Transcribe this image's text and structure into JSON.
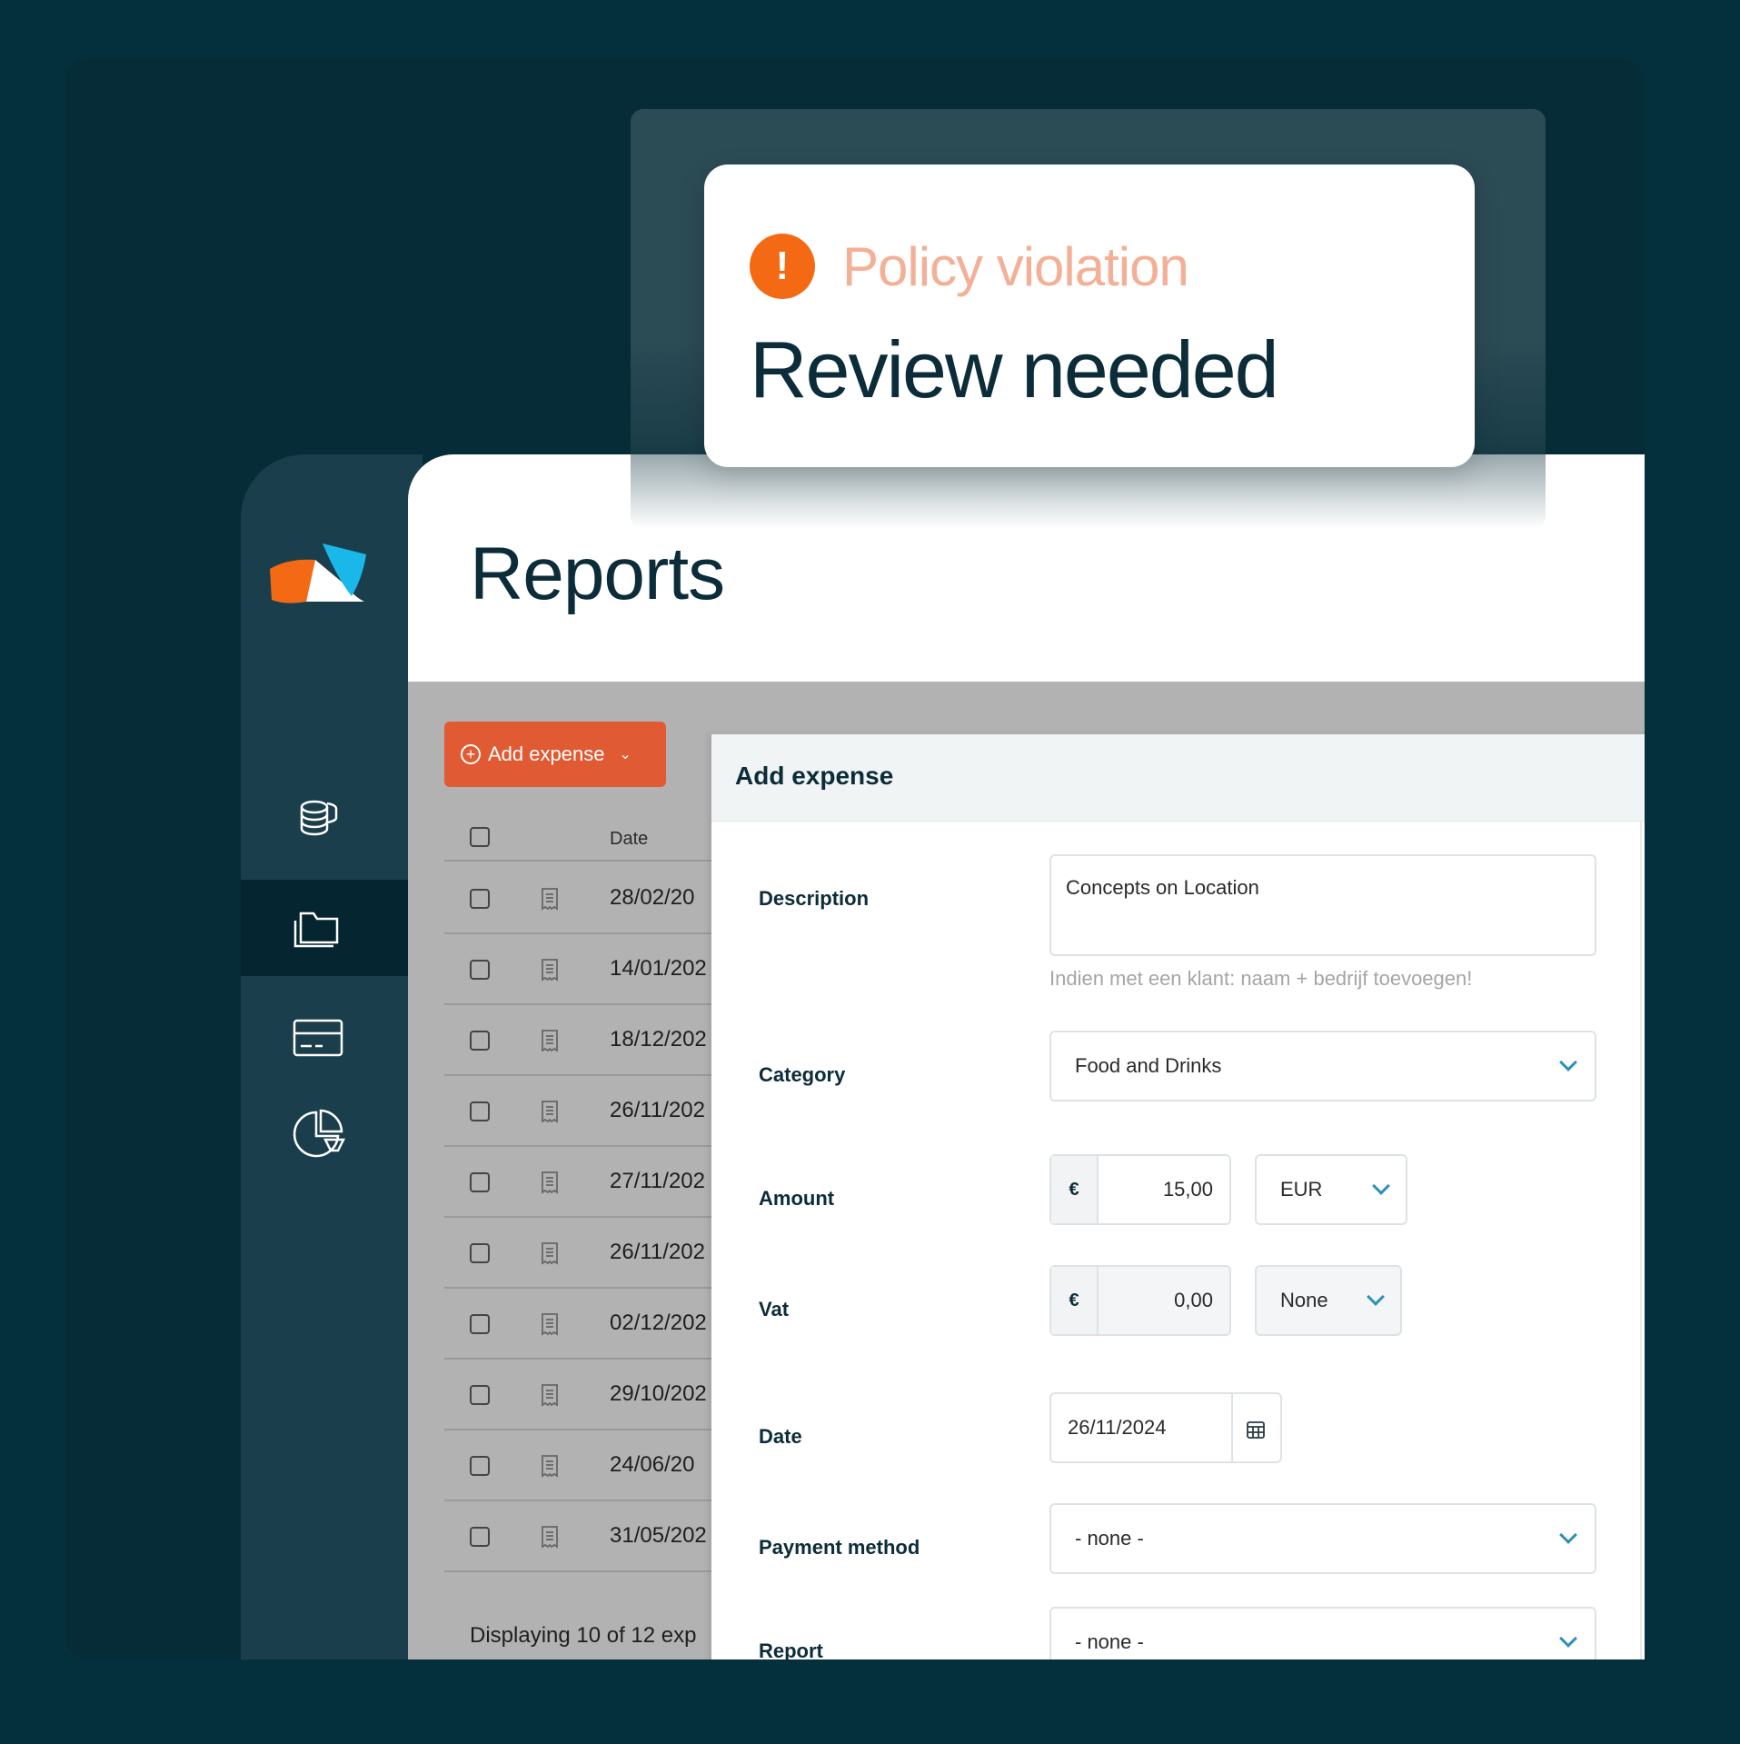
{
  "popup": {
    "warning_icon": "exclamation-icon",
    "warning_glyph": "!",
    "title": "Policy violation",
    "subtitle": "Review needed"
  },
  "page": {
    "title": "Reports"
  },
  "sidebar": {
    "items": [
      {
        "icon": "coins-icon"
      },
      {
        "icon": "folder-icon",
        "active": true
      },
      {
        "icon": "card-icon"
      },
      {
        "icon": "pie-chart-icon"
      }
    ]
  },
  "toolbar": {
    "add_expense_label": "Add expense"
  },
  "table": {
    "date_header": "Date",
    "rows": [
      "28/02/20",
      "14/01/202",
      "18/12/202",
      "26/11/202",
      "27/11/202",
      "26/11/202",
      "02/12/202",
      "29/10/202",
      "24/06/20",
      "31/05/202"
    ],
    "footer": "Displaying 10 of 12 exp"
  },
  "modal": {
    "title": "Add expense",
    "description": {
      "label": "Description",
      "value": "Concepts on Location",
      "hint": "Indien met een klant: naam + bedrijf toevoegen!"
    },
    "category": {
      "label": "Category",
      "value": "Food and Drinks"
    },
    "amount": {
      "label": "Amount",
      "currency_symbol": "€",
      "value": "15,00",
      "currency": "EUR"
    },
    "vat": {
      "label": "Vat",
      "currency_symbol": "€",
      "value": "0,00",
      "rate": "None"
    },
    "date": {
      "label": "Date",
      "value": "26/11/2024"
    },
    "payment_method": {
      "label": "Payment method",
      "value": "- none -"
    },
    "report": {
      "label": "Report",
      "value": "- none -"
    }
  },
  "colors": {
    "background": "#03303c",
    "accent": "#e05a33",
    "warning": "#f46a14",
    "sidebar": "#1a3e4c"
  }
}
